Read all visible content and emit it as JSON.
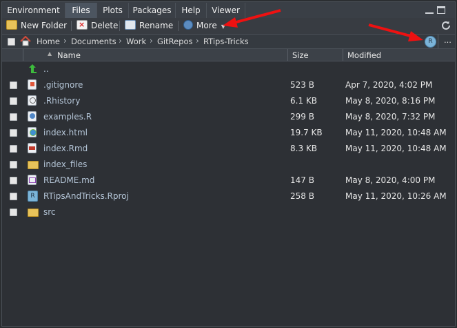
{
  "tabs": [
    {
      "label": "Environment"
    },
    {
      "label": "Files"
    },
    {
      "label": "Plots"
    },
    {
      "label": "Packages"
    },
    {
      "label": "Help"
    },
    {
      "label": "Viewer"
    }
  ],
  "active_tab": "Files",
  "toolbar": {
    "new_folder": "New Folder",
    "delete": "Delete",
    "rename": "Rename",
    "more": "More"
  },
  "breadcrumb": [
    "Home",
    "Documents",
    "Work",
    "GitRepos",
    "RTips-Tricks"
  ],
  "breadcrumb_more": "...",
  "columns": {
    "name": "Name",
    "size": "Size",
    "modified": "Modified"
  },
  "parent_dir": "..",
  "files": [
    {
      "name": ".gitignore",
      "size": "523 B",
      "modified": "Apr 7, 2020, 4:02 PM",
      "icon": "gitignore-file-icon"
    },
    {
      "name": ".Rhistory",
      "size": "6.1 KB",
      "modified": "May 8, 2020, 8:16 PM",
      "icon": "rhistory-file-icon"
    },
    {
      "name": "examples.R",
      "size": "299 B",
      "modified": "May 8, 2020, 7:32 PM",
      "icon": "r-script-file-icon"
    },
    {
      "name": "index.html",
      "size": "19.7 KB",
      "modified": "May 11, 2020, 10:48 AM",
      "icon": "html-file-icon"
    },
    {
      "name": "index.Rmd",
      "size": "8.3 KB",
      "modified": "May 11, 2020, 10:48 AM",
      "icon": "rmd-file-icon"
    },
    {
      "name": "index_files",
      "size": "",
      "modified": "",
      "icon": "folder-icon"
    },
    {
      "name": "README.md",
      "size": "147 B",
      "modified": "May 8, 2020, 4:00 PM",
      "icon": "markdown-file-icon"
    },
    {
      "name": "RTipsAndTricks.Rproj",
      "size": "258 B",
      "modified": "May 11, 2020, 10:26 AM",
      "icon": "rproj-file-icon"
    },
    {
      "name": "src",
      "size": "",
      "modified": "",
      "icon": "folder-icon"
    }
  ],
  "colors": {
    "accent_arrow": "#ee1111",
    "link_text": "#b5c6d8",
    "panel_bg": "#2d3035"
  }
}
